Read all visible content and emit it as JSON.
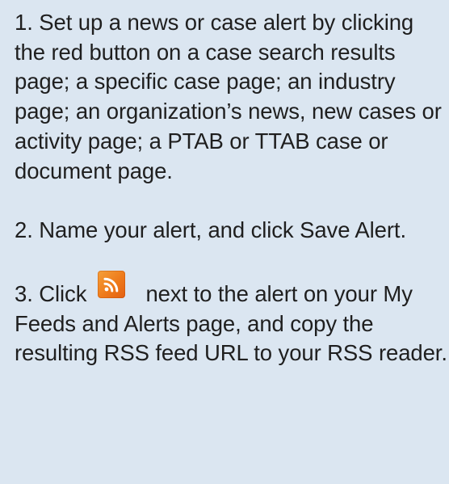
{
  "steps": [
    {
      "text": "1. Set up a news or case alert by clicking the red button on a case search results page; a specific case page; an industry page; an organization’s news, new cases or activity page; a PTAB or TTAB case or document page."
    },
    {
      "text": "2. Name your alert, and click Save Alert."
    },
    {
      "text_before": "3. Click",
      "icon": "rss-feed-icon",
      "text_after": "next to the alert on your My Feeds and Alerts page, and copy the resulting RSS feed URL to your RSS reader."
    }
  ],
  "colors": {
    "background": "#dbe6f1",
    "text": "#1f1f1f",
    "rss_orange": "#ee7a1b"
  }
}
